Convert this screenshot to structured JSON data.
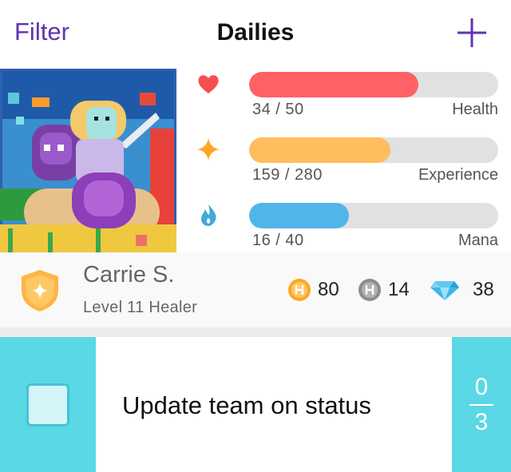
{
  "navbar": {
    "filter_label": "Filter",
    "title": "Dailies",
    "add_icon": "plus-icon"
  },
  "stats": [
    {
      "icon": "heart-icon",
      "value": "34 / 50",
      "label": "Health",
      "current": 34,
      "max": 50,
      "color": "#ff6165"
    },
    {
      "icon": "star-icon",
      "value": "159 / 280",
      "label": "Experience",
      "current": 159,
      "max": 280,
      "color": "#ffbe5d"
    },
    {
      "icon": "flame-icon",
      "value": "16 / 40",
      "label": "Mana",
      "current": 16,
      "max": 40,
      "color": "#50b5e9"
    }
  ],
  "profile": {
    "name": "Carrie S.",
    "level": "Level 11 Healer",
    "class_icon": "healer-shield-icon",
    "gold": "80",
    "hourglasses": "14",
    "gems": "38"
  },
  "task": {
    "text": "Update team on status",
    "completed": false,
    "counter_current": "0",
    "counter_total": "3",
    "color": "#5ad8e6"
  }
}
